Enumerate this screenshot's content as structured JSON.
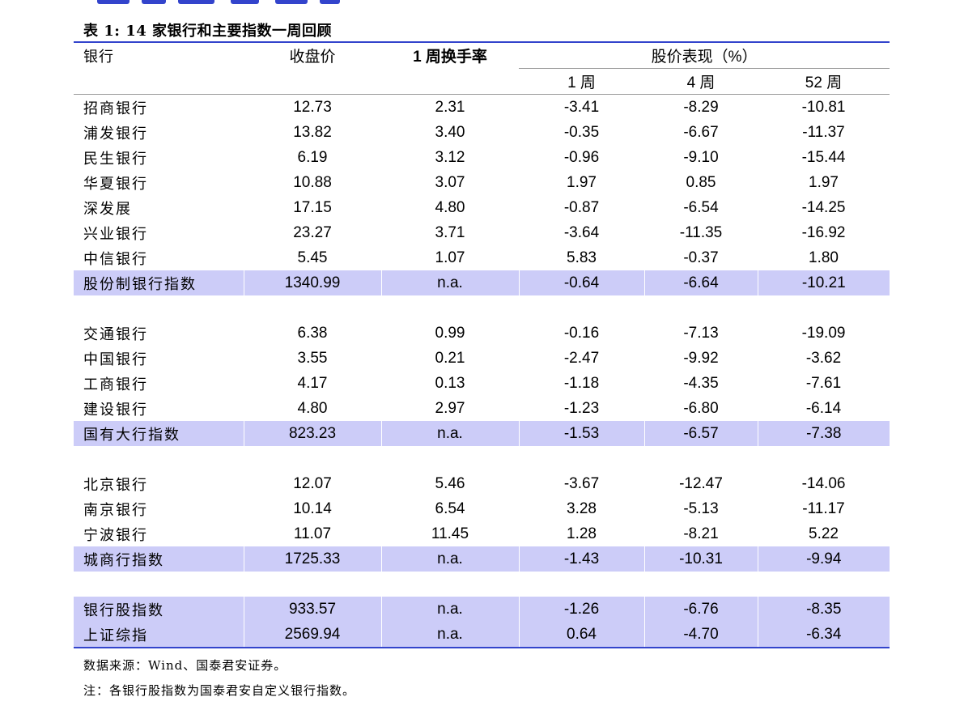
{
  "caption": "表 1: 14 家银行和主要指数一周回顾",
  "headers": {
    "bank": "银行",
    "close": "收盘价",
    "turnover": "1 周换手率",
    "perf": "股价表现（%）",
    "w1": "1 周",
    "w4": "4 周",
    "w52": "52 周"
  },
  "groups": [
    {
      "rows": [
        {
          "name": "招商银行",
          "close": "12.73",
          "turnover": "2.31",
          "w1": "-3.41",
          "w4": "-8.29",
          "w52": "-10.81"
        },
        {
          "name": "浦发银行",
          "close": "13.82",
          "turnover": "3.40",
          "w1": "-0.35",
          "w4": "-6.67",
          "w52": "-11.37"
        },
        {
          "name": "民生银行",
          "close": "6.19",
          "turnover": "3.12",
          "w1": "-0.96",
          "w4": "-9.10",
          "w52": "-15.44"
        },
        {
          "name": "华夏银行",
          "close": "10.88",
          "turnover": "3.07",
          "w1": "1.97",
          "w4": "0.85",
          "w52": "1.97"
        },
        {
          "name": "深发展",
          "close": "17.15",
          "turnover": "4.80",
          "w1": "-0.87",
          "w4": "-6.54",
          "w52": "-14.25"
        },
        {
          "name": "兴业银行",
          "close": "23.27",
          "turnover": "3.71",
          "w1": "-3.64",
          "w4": "-11.35",
          "w52": "-16.92"
        },
        {
          "name": "中信银行",
          "close": "5.45",
          "turnover": "1.07",
          "w1": "5.83",
          "w4": "-0.37",
          "w52": "1.80"
        }
      ],
      "index": {
        "name": "股份制银行指数",
        "close": "1340.99",
        "turnover": "n.a.",
        "w1": "-0.64",
        "w4": "-6.64",
        "w52": "-10.21"
      }
    },
    {
      "rows": [
        {
          "name": "交通银行",
          "close": "6.38",
          "turnover": "0.99",
          "w1": "-0.16",
          "w4": "-7.13",
          "w52": "-19.09"
        },
        {
          "name": "中国银行",
          "close": "3.55",
          "turnover": "0.21",
          "w1": "-2.47",
          "w4": "-9.92",
          "w52": "-3.62"
        },
        {
          "name": "工商银行",
          "close": "4.17",
          "turnover": "0.13",
          "w1": "-1.18",
          "w4": "-4.35",
          "w52": "-7.61"
        },
        {
          "name": "建设银行",
          "close": "4.80",
          "turnover": "2.97",
          "w1": "-1.23",
          "w4": "-6.80",
          "w52": "-6.14"
        }
      ],
      "index": {
        "name": "国有大行指数",
        "close": "823.23",
        "turnover": "n.a.",
        "w1": "-1.53",
        "w4": "-6.57",
        "w52": "-7.38"
      }
    },
    {
      "rows": [
        {
          "name": "北京银行",
          "close": "12.07",
          "turnover": "5.46",
          "w1": "-3.67",
          "w4": "-12.47",
          "w52": "-14.06"
        },
        {
          "name": "南京银行",
          "close": "10.14",
          "turnover": "6.54",
          "w1": "3.28",
          "w4": "-5.13",
          "w52": "-11.17"
        },
        {
          "name": "宁波银行",
          "close": "11.07",
          "turnover": "11.45",
          "w1": "1.28",
          "w4": "-8.21",
          "w52": "5.22"
        }
      ],
      "index": {
        "name": "城商行指数",
        "close": "1725.33",
        "turnover": "n.a.",
        "w1": "-1.43",
        "w4": "-10.31",
        "w52": "-9.94"
      }
    }
  ],
  "summary": [
    {
      "name": "银行股指数",
      "close": "933.57",
      "turnover": "n.a.",
      "w1": "-1.26",
      "w4": "-6.76",
      "w52": "-8.35"
    },
    {
      "name": "上证综指",
      "close": "2569.94",
      "turnover": "n.a.",
      "w1": "0.64",
      "w4": "-4.70",
      "w52": "-6.34"
    }
  ],
  "source": "数据来源：Wind、国泰君安证券。",
  "note": "注：各银行股指数为国泰君安自定义银行指数。",
  "colors": {
    "rule": "#3344cc",
    "highlight": "#ccccf8"
  }
}
